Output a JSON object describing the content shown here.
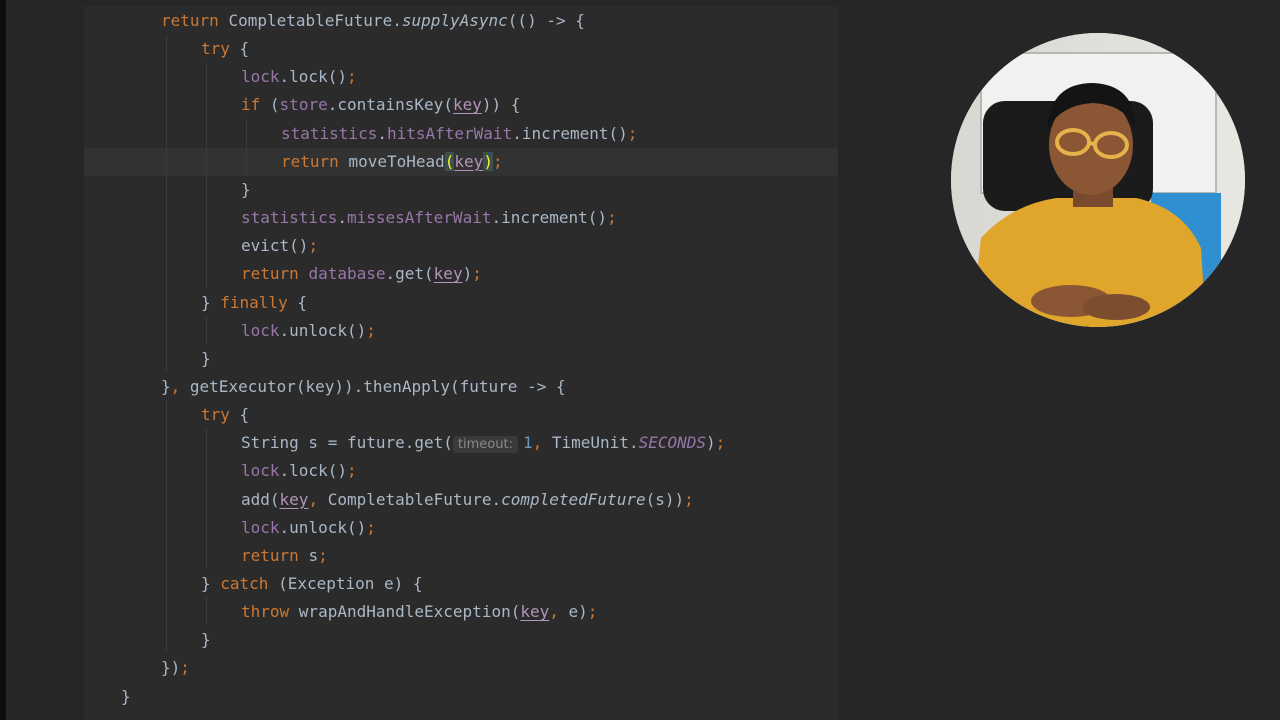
{
  "editor": {
    "lines": [
      {
        "tokens": [
          {
            "t": "return ",
            "c": "kw"
          },
          {
            "t": "CompletableFuture."
          },
          {
            "t": "supplyAsync",
            "c": "mth"
          },
          {
            "t": "(() -> {"
          }
        ]
      },
      {
        "tokens": [
          {
            "t": "try ",
            "c": "kw"
          },
          {
            "t": "{"
          }
        ]
      },
      {
        "tokens": [
          {
            "t": "lock",
            "c": "fld"
          },
          {
            "t": ".lock()"
          },
          {
            "t": ";",
            "c": "kw"
          }
        ]
      },
      {
        "tokens": [
          {
            "t": "if ",
            "c": "kw"
          },
          {
            "t": "("
          },
          {
            "t": "store",
            "c": "fld"
          },
          {
            "t": ".containsKey("
          },
          {
            "t": "key",
            "c": "param"
          },
          {
            "t": ")) {"
          }
        ]
      },
      {
        "tokens": [
          {
            "t": "statistics",
            "c": "fld"
          },
          {
            "t": "."
          },
          {
            "t": "hitsAfterWait",
            "c": "fld"
          },
          {
            "t": ".increment()"
          },
          {
            "t": ";",
            "c": "kw"
          }
        ]
      },
      {
        "tokens": [
          {
            "t": "return ",
            "c": "kw"
          },
          {
            "t": "moveToHead"
          },
          {
            "t": "(",
            "c": "brace-hl"
          },
          {
            "t": "key",
            "c": "param"
          },
          {
            "t": ")",
            "c": "brace-hl"
          },
          {
            "t": ";",
            "c": "kw"
          }
        ]
      },
      {
        "tokens": [
          {
            "t": "}"
          }
        ]
      },
      {
        "tokens": [
          {
            "t": "statistics",
            "c": "fld"
          },
          {
            "t": "."
          },
          {
            "t": "missesAfterWait",
            "c": "fld"
          },
          {
            "t": ".increment()"
          },
          {
            "t": ";",
            "c": "kw"
          }
        ]
      },
      {
        "tokens": [
          {
            "t": "evict()"
          },
          {
            "t": ";",
            "c": "kw"
          }
        ]
      },
      {
        "tokens": [
          {
            "t": "return ",
            "c": "kw"
          },
          {
            "t": "database",
            "c": "fld"
          },
          {
            "t": ".get("
          },
          {
            "t": "key",
            "c": "param"
          },
          {
            "t": ")"
          },
          {
            "t": ";",
            "c": "kw"
          }
        ]
      },
      {
        "tokens": [
          {
            "t": "} "
          },
          {
            "t": "finally ",
            "c": "kw"
          },
          {
            "t": "{"
          }
        ]
      },
      {
        "tokens": [
          {
            "t": "lock",
            "c": "fld"
          },
          {
            "t": ".unlock()"
          },
          {
            "t": ";",
            "c": "kw"
          }
        ]
      },
      {
        "tokens": [
          {
            "t": "}"
          }
        ]
      },
      {
        "tokens": [
          {
            "t": "}"
          },
          {
            "t": ", ",
            "c": "kw"
          },
          {
            "t": "getExecutor(key)).thenApply(future -> {"
          }
        ]
      },
      {
        "tokens": [
          {
            "t": "try ",
            "c": "kw"
          },
          {
            "t": "{"
          }
        ]
      },
      {
        "tokens": [
          {
            "t": "String s = future.get("
          },
          {
            "t": "timeout:",
            "c": "hint"
          },
          {
            "t": "1",
            "c": "num"
          },
          {
            "t": ", ",
            "c": "kw"
          },
          {
            "t": "TimeUnit."
          },
          {
            "t": "SECONDS",
            "c": "stat"
          },
          {
            "t": ")"
          },
          {
            "t": ";",
            "c": "kw"
          }
        ]
      },
      {
        "tokens": [
          {
            "t": "lock",
            "c": "fld"
          },
          {
            "t": ".lock()"
          },
          {
            "t": ";",
            "c": "kw"
          }
        ]
      },
      {
        "tokens": [
          {
            "t": "add("
          },
          {
            "t": "key",
            "c": "param"
          },
          {
            "t": ", ",
            "c": "kw"
          },
          {
            "t": "CompletableFuture."
          },
          {
            "t": "completedFuture",
            "c": "mth"
          },
          {
            "t": "(s))"
          },
          {
            "t": ";",
            "c": "kw"
          }
        ]
      },
      {
        "tokens": [
          {
            "t": "lock",
            "c": "fld"
          },
          {
            "t": ".unlock()"
          },
          {
            "t": ";",
            "c": "kw"
          }
        ]
      },
      {
        "tokens": [
          {
            "t": "return ",
            "c": "kw"
          },
          {
            "t": "s"
          },
          {
            "t": ";",
            "c": "kw"
          }
        ]
      },
      {
        "tokens": [
          {
            "t": "} "
          },
          {
            "t": "catch ",
            "c": "kw"
          },
          {
            "t": "(Exception e) {"
          }
        ]
      },
      {
        "tokens": [
          {
            "t": "throw ",
            "c": "kw"
          },
          {
            "t": "wrapAndHandleException("
          },
          {
            "t": "key",
            "c": "param"
          },
          {
            "t": ", ",
            "c": "kw"
          },
          {
            "t": "e)"
          },
          {
            "t": ";",
            "c": "kw"
          }
        ]
      },
      {
        "tokens": [
          {
            "t": "}"
          }
        ]
      },
      {
        "tokens": [
          {
            "t": "})"
          },
          {
            "t": ";",
            "c": "kw"
          }
        ]
      },
      {
        "tokens": [
          {
            "t": "}"
          }
        ]
      }
    ]
  },
  "colors": {
    "background": "#262626",
    "editor_background": "#2b2b2b",
    "keyword": "#cc7832",
    "field": "#9876aa",
    "default_text": "#a9b7c6",
    "number": "#6897bb"
  },
  "webcam": {
    "icon": "presenter-video-icon",
    "shape": "circle"
  }
}
